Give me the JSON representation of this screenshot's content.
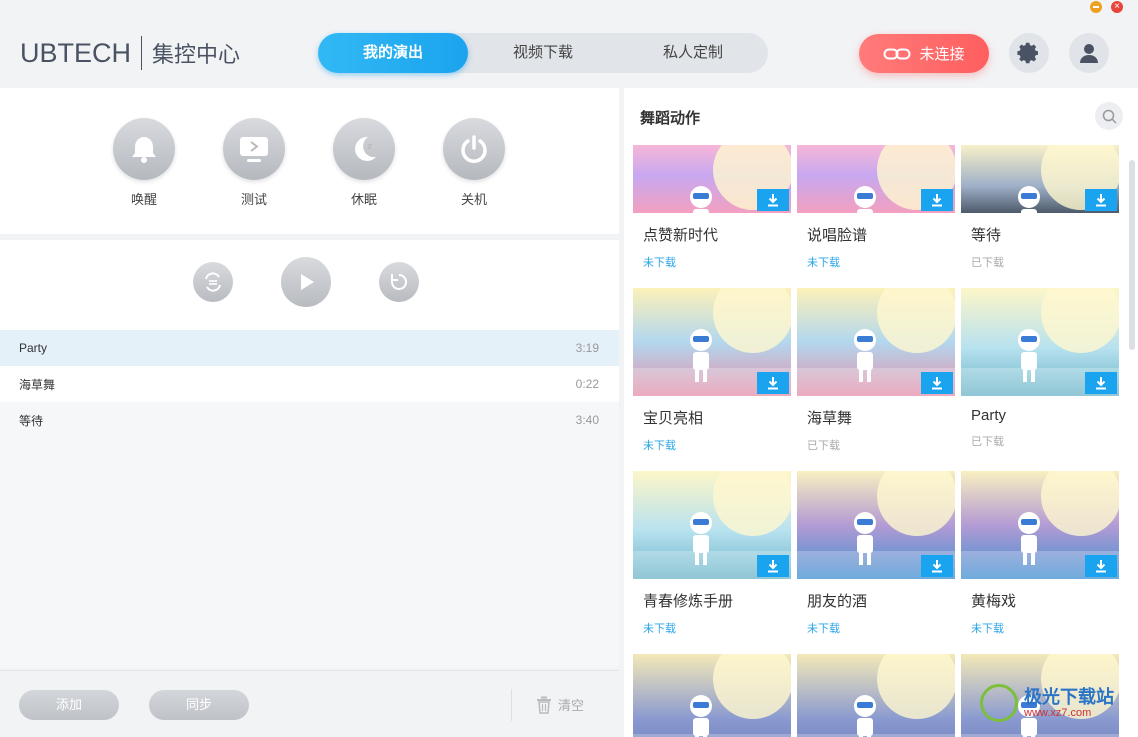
{
  "header": {
    "logo_brand": "UBTECH",
    "logo_sub": "集控中心",
    "tabs": [
      {
        "label": "我的演出"
      },
      {
        "label": "视频下载"
      },
      {
        "label": "私人定制"
      }
    ],
    "connect_label": "未连接"
  },
  "commands": [
    {
      "label": "唤醒",
      "icon": "bell-icon"
    },
    {
      "label": "测试",
      "icon": "screen-icon"
    },
    {
      "label": "休眠",
      "icon": "moon-icon"
    },
    {
      "label": "关机",
      "icon": "power-icon"
    }
  ],
  "playlist": [
    {
      "name": "Party",
      "duration": "3:19"
    },
    {
      "name": "海草舞",
      "duration": "0:22"
    },
    {
      "name": "等待",
      "duration": "3:40"
    }
  ],
  "footer": {
    "add_label": "添加",
    "sync_label": "同步",
    "clear_label": "清空"
  },
  "right": {
    "title": "舞蹈动作",
    "cards": [
      {
        "name": "点赞新时代",
        "status": "未下载"
      },
      {
        "name": "说唱脸谱",
        "status": "未下载"
      },
      {
        "name": "等待",
        "status": "已下载"
      },
      {
        "name": "宝贝亮相",
        "status": "未下载"
      },
      {
        "name": "海草舞",
        "status": "已下载"
      },
      {
        "name": "Party",
        "status": "已下载"
      },
      {
        "name": "青春修炼手册",
        "status": "未下载"
      },
      {
        "name": "朋友的酒",
        "status": "未下载"
      },
      {
        "name": "黄梅戏",
        "status": "未下载"
      },
      {
        "name": "",
        "status": ""
      },
      {
        "name": "",
        "status": ""
      },
      {
        "name": "",
        "status": ""
      }
    ]
  },
  "watermark": {
    "cn": "极光下载站",
    "url": "www.xz7.com"
  },
  "colors": {
    "accent": "#1ba3ee",
    "danger": "#ff5e5e",
    "downloaded": "#aaaaaa",
    "not_downloaded": "#2aa5e8"
  }
}
